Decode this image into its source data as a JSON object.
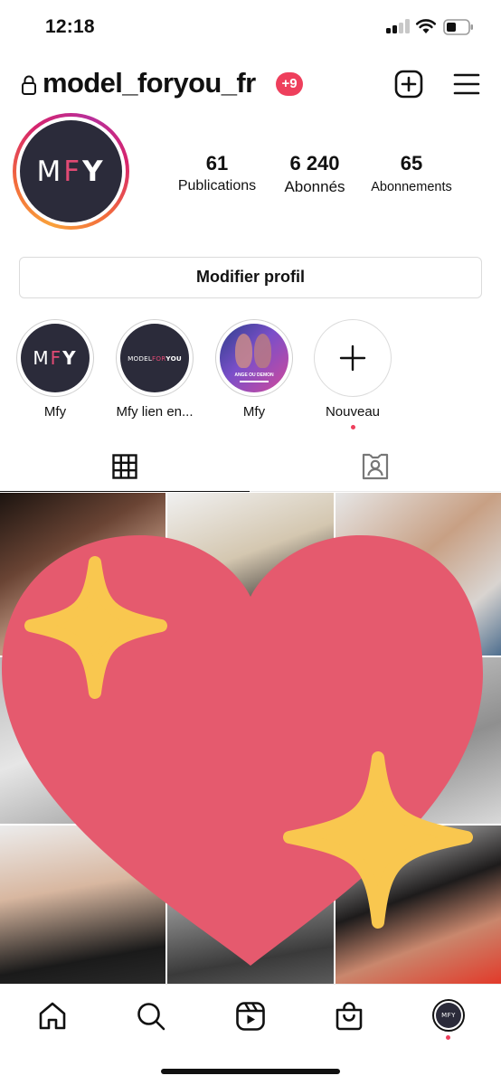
{
  "status_bar": {
    "time": "12:18"
  },
  "header": {
    "username": "model_foryou_fr",
    "notification_badge": "+9"
  },
  "profile": {
    "logo_letters": [
      "M",
      "F",
      "Y"
    ],
    "stats": [
      {
        "value": "61",
        "label": "Publications"
      },
      {
        "value": "6 240",
        "label": "Abonnés"
      },
      {
        "value": "65",
        "label": "Abonnements"
      }
    ],
    "edit_button": "Modifier profil"
  },
  "highlights": [
    {
      "label": "Mfy",
      "cover_text": [
        "M",
        "F",
        "Y"
      ]
    },
    {
      "label": "Mfy lien en...",
      "cover_text": [
        "MODEL",
        "FOR",
        "YOU"
      ]
    },
    {
      "label": "Mfy",
      "cover_text": [
        "ANGE OU DEMON"
      ]
    },
    {
      "label": "Nouveau"
    }
  ],
  "tabs": [
    {
      "name": "grid",
      "icon": "grid-icon",
      "active": true
    },
    {
      "name": "tagged",
      "icon": "tagged-person-icon",
      "active": false
    }
  ],
  "bottom_nav": [
    {
      "name": "home",
      "icon": "home-icon"
    },
    {
      "name": "search",
      "icon": "search-icon"
    },
    {
      "name": "reels",
      "icon": "reels-icon"
    },
    {
      "name": "shop",
      "icon": "shop-bag-icon"
    },
    {
      "name": "profile",
      "icon": "profile-avatar-icon",
      "avatar_text": "MFY"
    }
  ],
  "colors": {
    "badge": "#ee3f5c",
    "logo_dark": "#2b2b3a",
    "logo_accent": "#e14a74",
    "heart": "#e55a6e",
    "sparkle": "#f9c74f"
  }
}
